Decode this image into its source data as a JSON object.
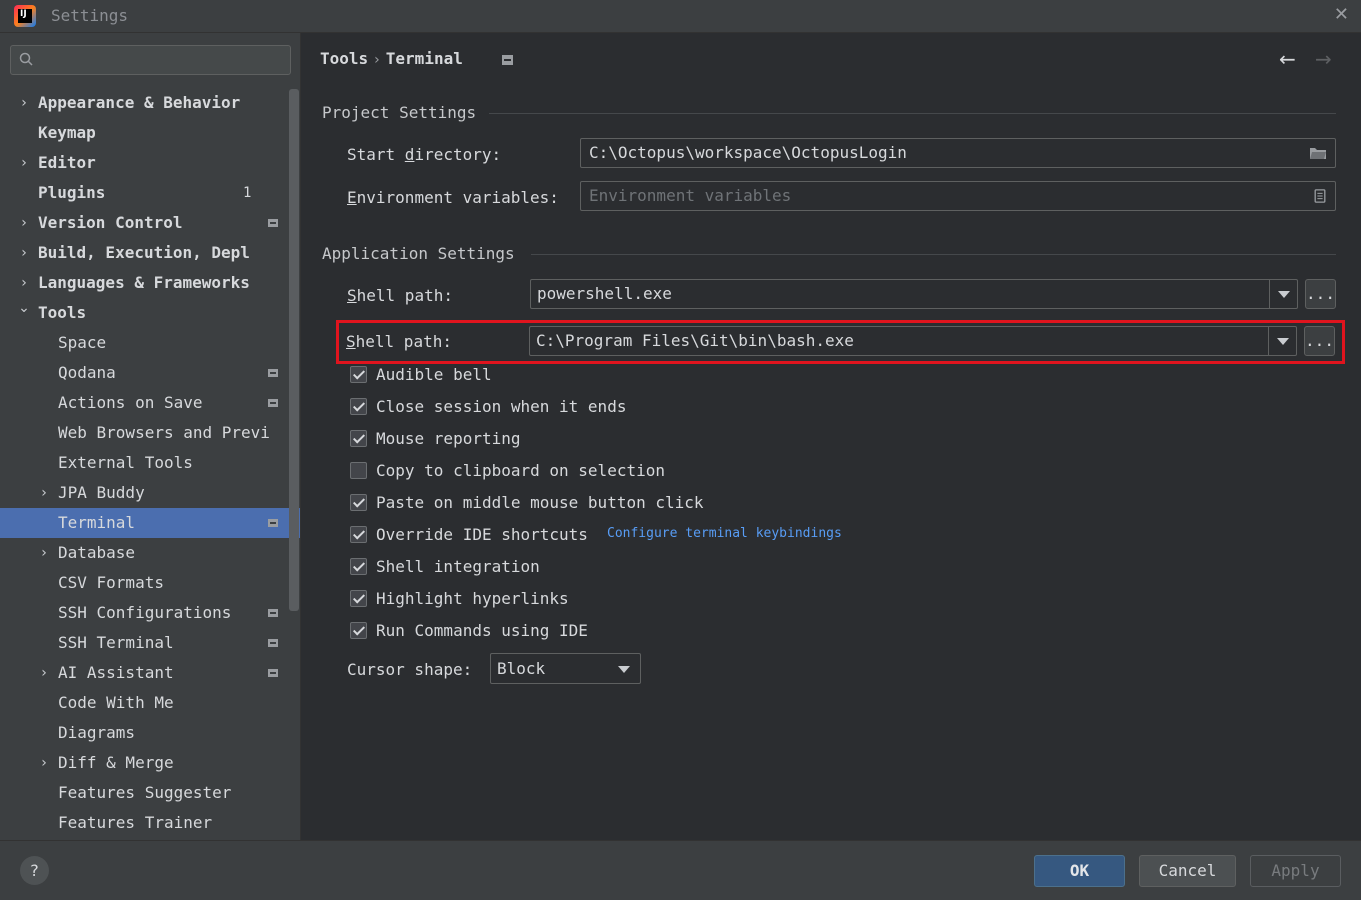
{
  "window": {
    "title": "Settings",
    "app_icon_text": "IJ"
  },
  "search": {
    "placeholder": ""
  },
  "sidebar": {
    "items": [
      {
        "label": "Appearance & Behavior",
        "level": 0,
        "bold": true,
        "expandable": true,
        "expanded": false
      },
      {
        "label": "Keymap",
        "level": 0,
        "bold": true
      },
      {
        "label": "Editor",
        "level": 0,
        "bold": true,
        "expandable": true,
        "expanded": false
      },
      {
        "label": "Plugins",
        "level": 0,
        "bold": true,
        "badge": "1"
      },
      {
        "label": "Version Control",
        "level": 0,
        "bold": true,
        "expandable": true,
        "expanded": false,
        "project_icon": true
      },
      {
        "label": "Build, Execution, Depl",
        "level": 0,
        "bold": true,
        "expandable": true,
        "expanded": false
      },
      {
        "label": "Languages & Frameworks",
        "level": 0,
        "bold": true,
        "expandable": true,
        "expanded": false
      },
      {
        "label": "Tools",
        "level": 0,
        "bold": true,
        "expandable": true,
        "expanded": true
      },
      {
        "label": "Space",
        "level": 1
      },
      {
        "label": "Qodana",
        "level": 1,
        "project_icon": true
      },
      {
        "label": "Actions on Save",
        "level": 1,
        "project_icon": true
      },
      {
        "label": "Web Browsers and Previ",
        "level": 1
      },
      {
        "label": "External Tools",
        "level": 1
      },
      {
        "label": "JPA Buddy",
        "level": 1,
        "expandable": true,
        "expanded": false
      },
      {
        "label": "Terminal",
        "level": 1,
        "selected": true,
        "project_icon": true
      },
      {
        "label": "Database",
        "level": 1,
        "expandable": true,
        "expanded": false
      },
      {
        "label": "CSV Formats",
        "level": 1
      },
      {
        "label": "SSH Configurations",
        "level": 1,
        "project_icon": true
      },
      {
        "label": "SSH Terminal",
        "level": 1,
        "project_icon": true
      },
      {
        "label": "AI Assistant",
        "level": 1,
        "expandable": true,
        "expanded": false,
        "project_icon": true
      },
      {
        "label": "Code With Me",
        "level": 1
      },
      {
        "label": "Diagrams",
        "level": 1
      },
      {
        "label": "Diff & Merge",
        "level": 1,
        "expandable": true,
        "expanded": false
      },
      {
        "label": "Features Suggester",
        "level": 1
      },
      {
        "label": "Features Trainer",
        "level": 1
      }
    ]
  },
  "breadcrumb": {
    "parent": "Tools",
    "separator": "›",
    "current": "Terminal"
  },
  "project_settings": {
    "header": "Project Settings",
    "start_directory": {
      "label_pre": "Start ",
      "label_mn": "d",
      "label_post": "irectory:",
      "value": "C:\\Octopus\\workspace\\OctopusLogin"
    },
    "env_vars": {
      "label_pre": "",
      "label_mn": "E",
      "label_post": "nvironment variables:",
      "placeholder": "Environment variables"
    }
  },
  "application_settings": {
    "header": "Application Settings",
    "shell_path_1": {
      "label_mn": "S",
      "label_post": "hell path:",
      "value": "powershell.exe"
    },
    "shell_path_2": {
      "label_mn": "S",
      "label_post": "hell path:",
      "value": "C:\\Program Files\\Git\\bin\\bash.exe"
    },
    "browse_label": "...",
    "checkboxes": [
      {
        "label": "Audible bell",
        "checked": true
      },
      {
        "label": "Close session when it ends",
        "checked": true
      },
      {
        "label": "Mouse reporting",
        "checked": true
      },
      {
        "label": "Copy to clipboard on selection",
        "checked": false
      },
      {
        "label": "Paste on middle mouse button click",
        "checked": true
      },
      {
        "label": "Override IDE shortcuts",
        "checked": true
      },
      {
        "label": "Shell integration",
        "checked": true
      },
      {
        "label": "Highlight hyperlinks",
        "checked": true
      },
      {
        "label": "Run Commands using IDE",
        "checked": true
      }
    ],
    "keybindings_link": "Configure terminal keybindings",
    "cursor_shape": {
      "label": "Cursor shape:",
      "value": "Block"
    }
  },
  "footer": {
    "help": "?",
    "ok": "OK",
    "cancel": "Cancel",
    "apply": "Apply"
  },
  "colors": {
    "accent_selection": "#4b6eaf",
    "ok_button": "#365880",
    "highlight": "#e0141e",
    "link": "#589df6"
  }
}
